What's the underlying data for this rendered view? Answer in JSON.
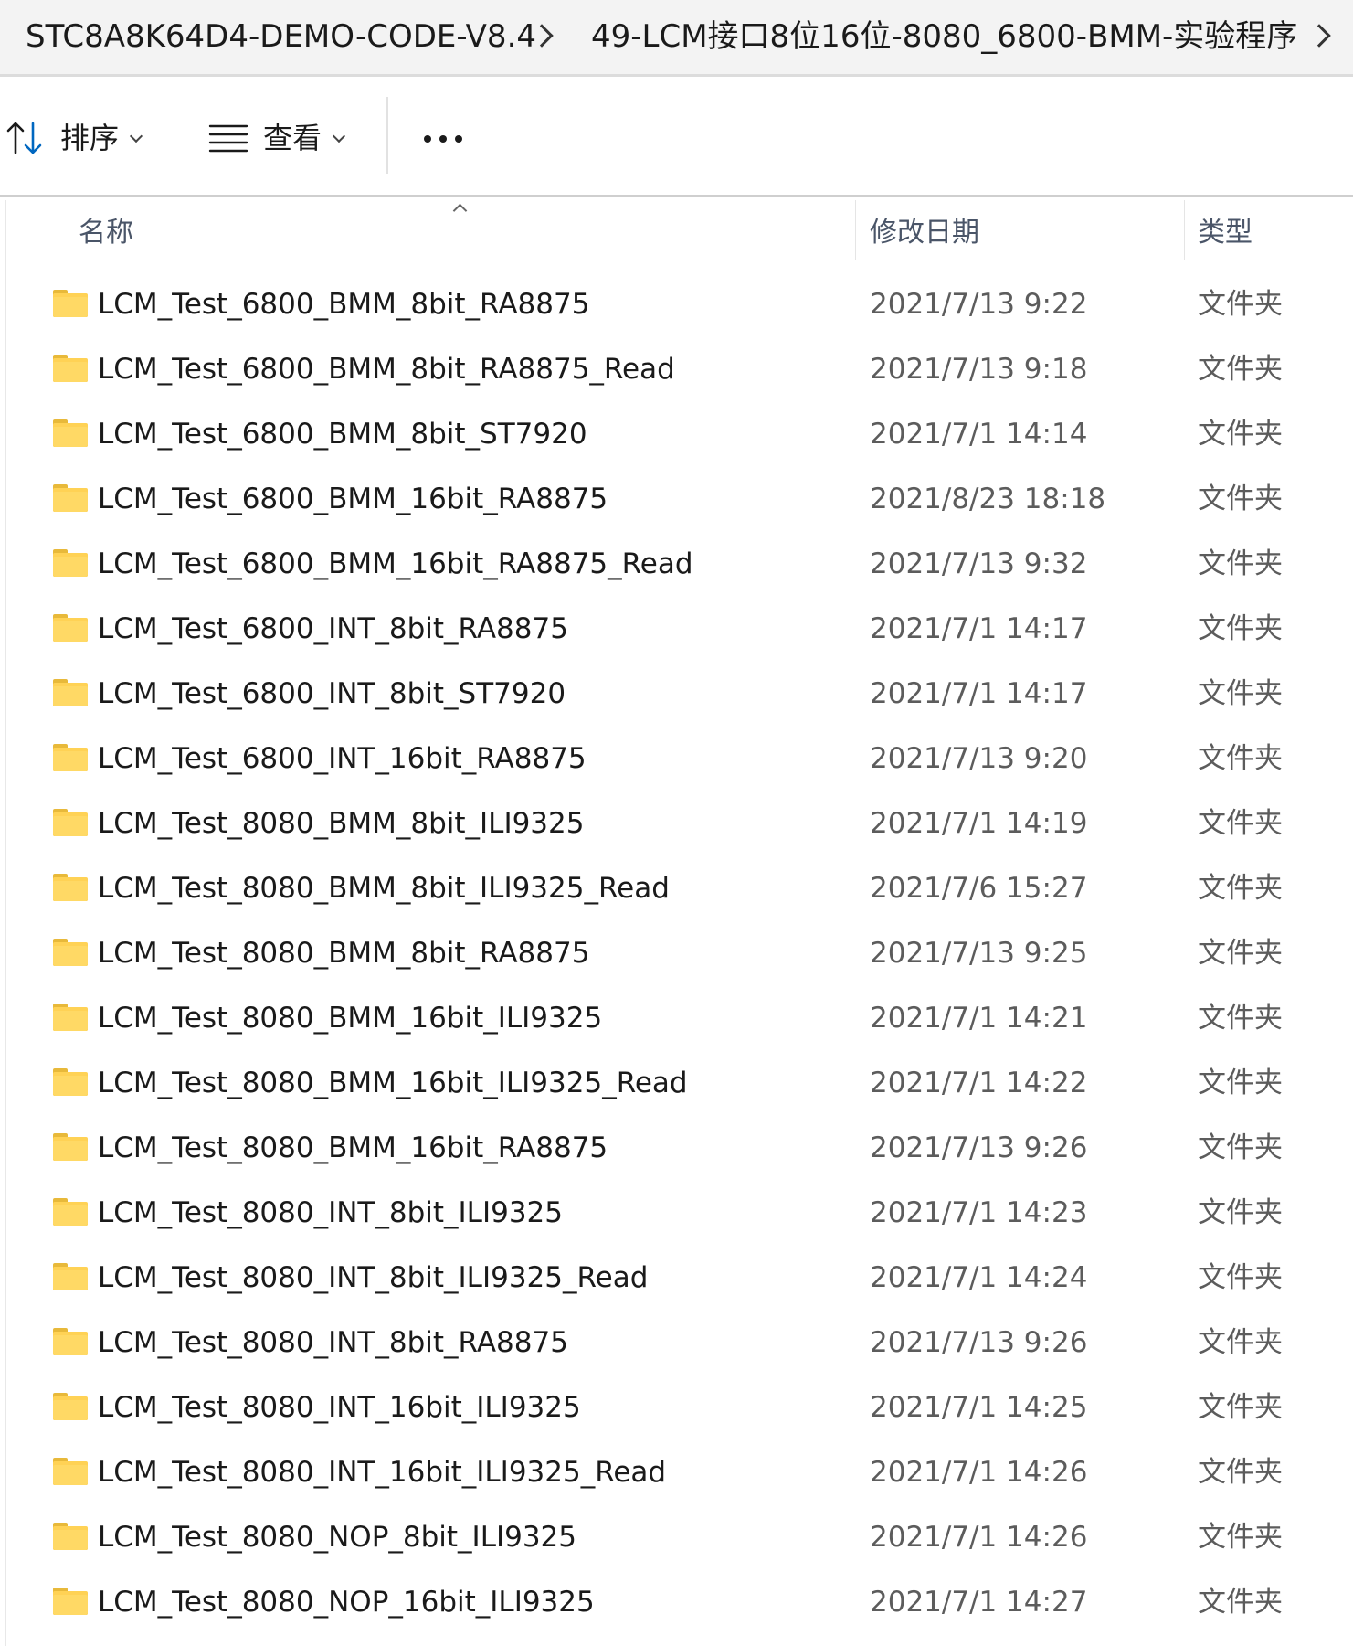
{
  "breadcrumb": {
    "items": [
      "STC8A8K64D4-DEMO-CODE-V8.4",
      "49-LCM接口8位16位-8080_6800-BMM-实验程序"
    ]
  },
  "toolbar": {
    "sort_label": "排序",
    "view_label": "查看",
    "sort_icon": "sort-arrows-icon",
    "view_icon": "list-view-icon",
    "more_icon": "more-options-icon"
  },
  "columns": {
    "name": "名称",
    "date": "修改日期",
    "type": "类型"
  },
  "colors": {
    "folder": "#ffd255",
    "accent": "#0067c0"
  },
  "files": [
    {
      "name": "LCM_Test_6800_BMM_8bit_RA8875",
      "date": "2021/7/13 9:22",
      "type": "文件夹"
    },
    {
      "name": "LCM_Test_6800_BMM_8bit_RA8875_Read",
      "date": "2021/7/13 9:18",
      "type": "文件夹"
    },
    {
      "name": "LCM_Test_6800_BMM_8bit_ST7920",
      "date": "2021/7/1 14:14",
      "type": "文件夹"
    },
    {
      "name": "LCM_Test_6800_BMM_16bit_RA8875",
      "date": "2021/8/23 18:18",
      "type": "文件夹"
    },
    {
      "name": "LCM_Test_6800_BMM_16bit_RA8875_Read",
      "date": "2021/7/13 9:32",
      "type": "文件夹"
    },
    {
      "name": "LCM_Test_6800_INT_8bit_RA8875",
      "date": "2021/7/1 14:17",
      "type": "文件夹"
    },
    {
      "name": "LCM_Test_6800_INT_8bit_ST7920",
      "date": "2021/7/1 14:17",
      "type": "文件夹"
    },
    {
      "name": "LCM_Test_6800_INT_16bit_RA8875",
      "date": "2021/7/13 9:20",
      "type": "文件夹"
    },
    {
      "name": "LCM_Test_8080_BMM_8bit_ILI9325",
      "date": "2021/7/1 14:19",
      "type": "文件夹"
    },
    {
      "name": "LCM_Test_8080_BMM_8bit_ILI9325_Read",
      "date": "2021/7/6 15:27",
      "type": "文件夹"
    },
    {
      "name": "LCM_Test_8080_BMM_8bit_RA8875",
      "date": "2021/7/13 9:25",
      "type": "文件夹"
    },
    {
      "name": "LCM_Test_8080_BMM_16bit_ILI9325",
      "date": "2021/7/1 14:21",
      "type": "文件夹"
    },
    {
      "name": "LCM_Test_8080_BMM_16bit_ILI9325_Read",
      "date": "2021/7/1 14:22",
      "type": "文件夹"
    },
    {
      "name": "LCM_Test_8080_BMM_16bit_RA8875",
      "date": "2021/7/13 9:26",
      "type": "文件夹"
    },
    {
      "name": "LCM_Test_8080_INT_8bit_ILI9325",
      "date": "2021/7/1 14:23",
      "type": "文件夹"
    },
    {
      "name": "LCM_Test_8080_INT_8bit_ILI9325_Read",
      "date": "2021/7/1 14:24",
      "type": "文件夹"
    },
    {
      "name": "LCM_Test_8080_INT_8bit_RA8875",
      "date": "2021/7/13 9:26",
      "type": "文件夹"
    },
    {
      "name": "LCM_Test_8080_INT_16bit_ILI9325",
      "date": "2021/7/1 14:25",
      "type": "文件夹"
    },
    {
      "name": "LCM_Test_8080_INT_16bit_ILI9325_Read",
      "date": "2021/7/1 14:26",
      "type": "文件夹"
    },
    {
      "name": "LCM_Test_8080_NOP_8bit_ILI9325",
      "date": "2021/7/1 14:26",
      "type": "文件夹"
    },
    {
      "name": "LCM_Test_8080_NOP_16bit_ILI9325",
      "date": "2021/7/1 14:27",
      "type": "文件夹"
    }
  ]
}
